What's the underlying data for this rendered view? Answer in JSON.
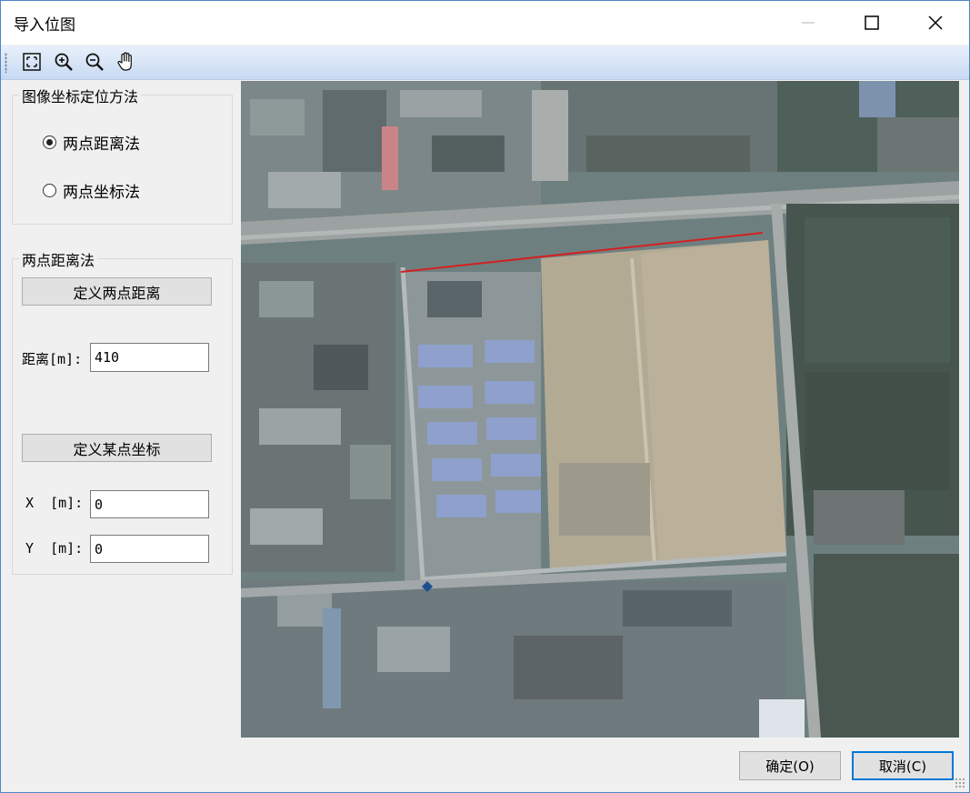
{
  "window": {
    "title": "导入位图"
  },
  "toolbar": {
    "tools": [
      {
        "name": "full-extent-icon"
      },
      {
        "name": "zoom-in-icon"
      },
      {
        "name": "zoom-out-icon"
      },
      {
        "name": "pan-hand-icon"
      }
    ]
  },
  "method_group": {
    "label": "图像坐标定位方法",
    "options": [
      {
        "label": "两点距离法",
        "checked": true
      },
      {
        "label": "两点坐标法",
        "checked": false
      }
    ]
  },
  "distance_group": {
    "label": "两点距离法",
    "define_distance_button": "定义两点距离",
    "distance_label": "距离[m]:",
    "distance_value": "410",
    "define_point_button": "定义某点坐标",
    "x_label": "X  [m]:",
    "x_value": "0",
    "y_label": "Y  [m]:",
    "y_value": "0"
  },
  "footer": {
    "ok_label": "确定(O)",
    "cancel_label": "取消(C)"
  },
  "colors": {
    "accent": "#0078d7",
    "measure_line": "#d42020",
    "point_marker": "#1f4f8f"
  }
}
